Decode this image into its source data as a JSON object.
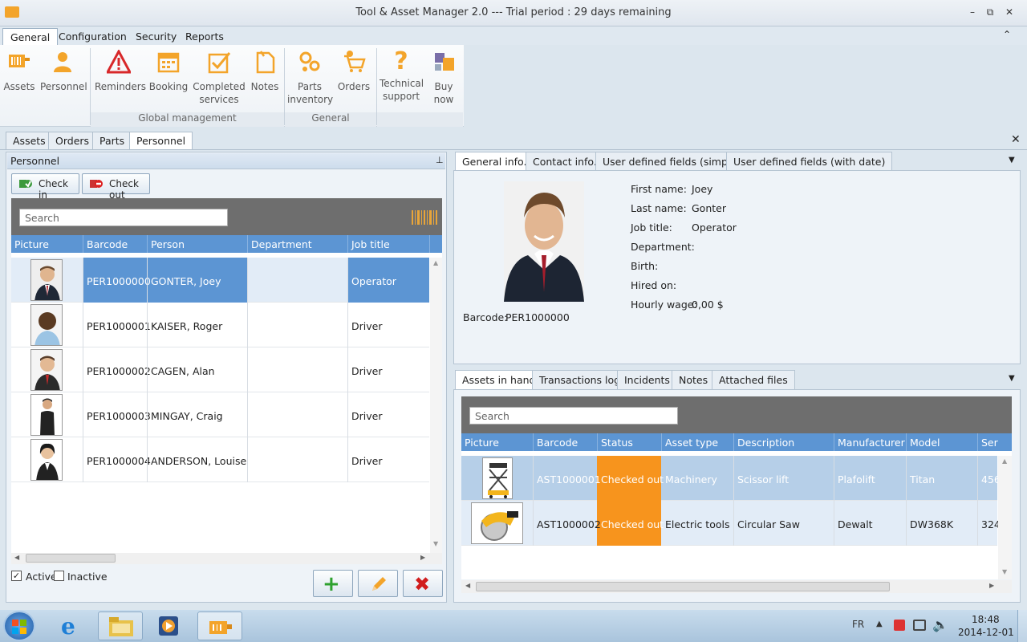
{
  "window": {
    "title": "Tool & Asset Manager 2.0 --- Trial period : 29 days remaining"
  },
  "menu": {
    "tabs": [
      "General",
      "Configuration",
      "Security",
      "Reports"
    ],
    "active": "General"
  },
  "ribbon": {
    "buttons": {
      "assets": "Assets",
      "personnel": "Personnel",
      "reminders": "Reminders",
      "booking": "Booking",
      "completed_1": "Completed",
      "completed_2": "services",
      "notes": "Notes",
      "parts_1": "Parts",
      "parts_2": "inventory",
      "orders": "Orders",
      "tech_1": "Technical",
      "tech_2": "support",
      "buy_1": "Buy",
      "buy_2": "now"
    },
    "groups": {
      "global": "Global management",
      "general": "General"
    }
  },
  "doc_tabs": [
    "Assets",
    "Orders",
    "Parts",
    "Personnel"
  ],
  "personnel_panel": {
    "title": "Personnel",
    "check_in": "Check in",
    "check_out": "Check out",
    "search_placeholder": "Search",
    "columns": [
      "Picture",
      "Barcode",
      "Person",
      "Department",
      "Job title"
    ],
    "rows": [
      {
        "barcode": "PER1000000",
        "person": "GONTER, Joey",
        "department": "",
        "job": "Operator"
      },
      {
        "barcode": "PER1000001",
        "person": "KAISER, Roger",
        "department": "",
        "job": "Driver"
      },
      {
        "barcode": "PER1000002",
        "person": "CAGEN, Alan",
        "department": "",
        "job": "Driver"
      },
      {
        "barcode": "PER1000003",
        "person": "MINGAY, Craig",
        "department": "",
        "job": "Driver"
      },
      {
        "barcode": "PER1000004",
        "person": "ANDERSON, Louise",
        "department": "",
        "job": "Driver"
      }
    ],
    "active_label": "Active",
    "inactive_label": "Inactive"
  },
  "detail": {
    "tabs": [
      "General info.",
      "Contact info.",
      "User defined fields (simple)",
      "User defined fields (with date)"
    ],
    "fields": {
      "first_name_label": "First name:",
      "first_name": "Joey",
      "last_name_label": "Last name:",
      "last_name": "Gonter",
      "job_title_label": "Job title:",
      "job_title": "Operator",
      "department_label": "Department:",
      "birth_label": "Birth:",
      "hired_label": "Hired on:",
      "wage_label": "Hourly wage:",
      "wage": "0,00 $",
      "barcode_label": "Barcode:",
      "barcode": "PER1000000"
    }
  },
  "assets_panel": {
    "tabs": [
      "Assets in hand",
      "Transactions log",
      "Incidents",
      "Notes",
      "Attached files"
    ],
    "search_placeholder": "Search",
    "columns": [
      "Picture",
      "Barcode",
      "Status",
      "Asset type",
      "Description",
      "Manufacturer",
      "Model",
      "Ser"
    ],
    "rows": [
      {
        "barcode": "AST1000001",
        "status": "Checked out",
        "type": "Machinery",
        "description": "Scissor lift",
        "manufacturer": "Plafolift",
        "model": "Titan",
        "serial": "456"
      },
      {
        "barcode": "AST1000002",
        "status": "Checked out",
        "type": "Electric tools",
        "description": "Circular Saw",
        "manufacturer": "Dewalt",
        "model": "DW368K",
        "serial": "324"
      }
    ]
  },
  "taskbar": {
    "lang": "FR",
    "time": "18:48",
    "date": "2014-12-01"
  },
  "colors": {
    "accent": "#5c95d3",
    "status_checked_out": "#f7941d",
    "ribbon_icon": "#f3a42a"
  }
}
